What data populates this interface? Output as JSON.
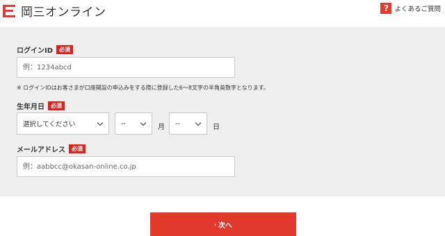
{
  "header": {
    "logo_text": "岡三オンライン",
    "faq_icon_glyph": "?",
    "faq_label": "よくあるご質問"
  },
  "form": {
    "login_id": {
      "label": "ログインID",
      "required_badge": "必須",
      "placeholder": "例：1234abcd",
      "value": ""
    },
    "login_id_note": "※ ログインIDはお客さまが口座開設の申込みをする際に登録した6～8文字の半角英数字となります。",
    "birthdate": {
      "label": "生年月日",
      "required_badge": "必須",
      "year_selected": "選択してください",
      "month_selected": "--",
      "month_unit": "月",
      "day_selected": "--",
      "day_unit": "日"
    },
    "email": {
      "label": "メールアドレス",
      "required_badge": "必須",
      "placeholder": "例：aabbcc@okasan-online.co.jp",
      "value": ""
    }
  },
  "next_button": {
    "arrow_glyph": "›",
    "label": "次へ"
  },
  "colors": {
    "brand_red": "#e3382c",
    "panel_bg": "#efefef"
  }
}
